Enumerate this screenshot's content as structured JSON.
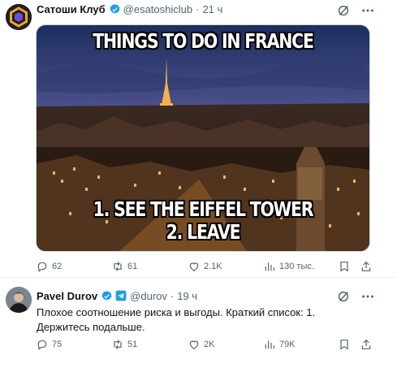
{
  "tweets": [
    {
      "author_name": "Сатоши Клуб",
      "handle": "@esatoshiclub",
      "separator": "·",
      "time": "21 ч",
      "verified": true,
      "verified_color": "#1d9bf0",
      "media": {
        "caption_top": "THINGS TO DO IN FRANCE",
        "caption_line1": "1. SEE THE EIFFEL TOWER",
        "caption_line2": "2. LEAVE"
      },
      "stats": {
        "replies": "62",
        "reposts": "61",
        "likes": "2.1K",
        "views": "130 тыс."
      }
    },
    {
      "author_name": "Pavel Durov",
      "handle": "@durov",
      "separator": "·",
      "time": "19 ч",
      "verified": true,
      "verified_color": "#1d9bf0",
      "text": "Плохое соотношение риска и выгоды. Краткий список: 1. Держитесь подальше.",
      "stats": {
        "replies": "75",
        "reposts": "51",
        "likes": "2K",
        "views": "79K"
      }
    }
  ],
  "icons": {
    "reply": "reply-icon",
    "repost": "repost-icon",
    "like": "heart-icon",
    "views": "views-icon",
    "bookmark": "bookmark-icon",
    "share": "share-icon",
    "grok": "grok-icon",
    "more": "more-icon"
  }
}
